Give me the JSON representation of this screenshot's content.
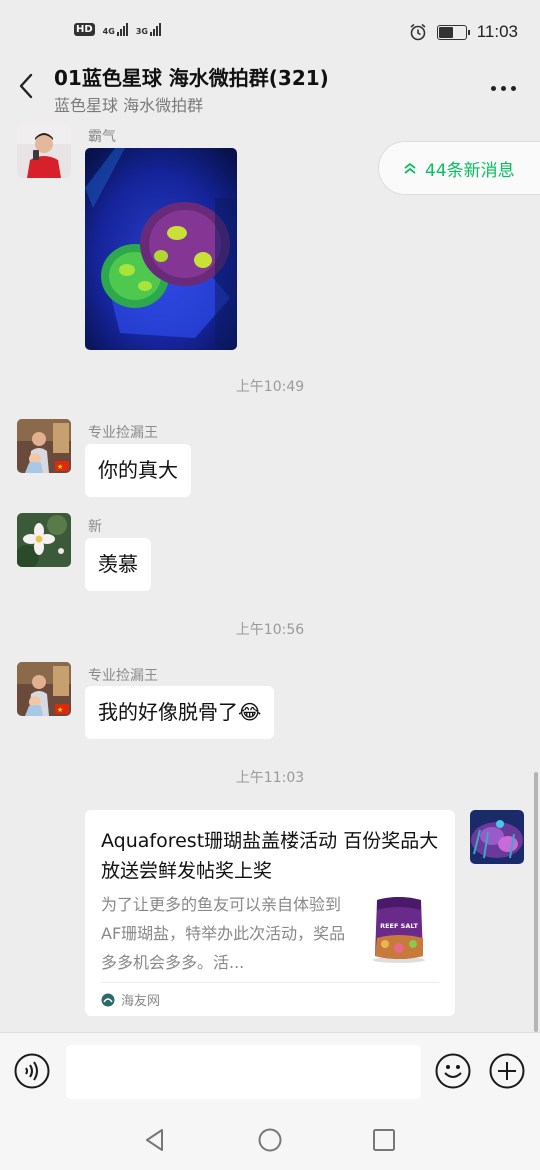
{
  "status_bar": {
    "hd_label": "HD",
    "sim1_label": "4G",
    "sim2_label": "3G",
    "battery_level": 0.5,
    "time": "11:03"
  },
  "header": {
    "title": "01蓝色星球 海水微拍群(321)",
    "subtitle": "蓝色星球 海水微拍群"
  },
  "new_messages": {
    "label": "44条新消息",
    "count": 44
  },
  "messages": [
    {
      "sender": "霸气",
      "type": "image"
    },
    {
      "timestamp": "上午10:49"
    },
    {
      "sender": "专业捡漏王",
      "text": "你的真大"
    },
    {
      "sender": "新",
      "text": "羡慕"
    },
    {
      "timestamp": "上午10:56"
    },
    {
      "sender": "专业捡漏王",
      "text": "我的好像脱骨了😂"
    },
    {
      "timestamp": "上午11:03"
    },
    {
      "type": "link_card",
      "title": "Aquaforest珊瑚盐盖楼活动 百份奖品大放送尝鲜发帖奖上奖",
      "description": "为了让更多的鱼友可以亲自体验到AF珊瑚盐，特举办此次活动，奖品多多机会多多。活...",
      "source": "海友网",
      "thumbnail_text": "REEF SALT"
    }
  ],
  "input": {
    "placeholder": ""
  },
  "colors": {
    "background": "#ededed",
    "accent_green": "#07c160",
    "bubble": "#ffffff",
    "meta_text": "#9a9a9a"
  },
  "icons": {
    "back": "chevron-left-icon",
    "more": "more-dots-icon",
    "new_messages": "double-chevron-up-icon",
    "voice": "voice-icon",
    "emoji": "emoji-icon",
    "plus": "plus-icon",
    "nav_back": "triangle-back-icon",
    "nav_home": "circle-home-icon",
    "nav_recent": "square-recent-icon"
  }
}
